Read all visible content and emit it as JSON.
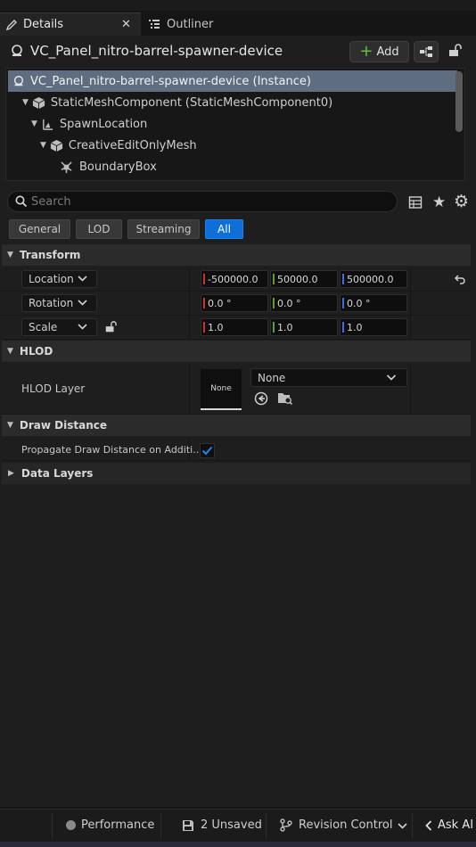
{
  "tabs": [
    {
      "label": "Details"
    },
    {
      "label": "Outliner"
    }
  ],
  "header": {
    "title": "VC_Panel_nitro-barrel-spawner-device",
    "add_label": "Add"
  },
  "tree": [
    {
      "label": "VC_Panel_nitro-barrel-spawner-device (Instance)"
    },
    {
      "label": "StaticMeshComponent (StaticMeshComponent0)"
    },
    {
      "label": "SpawnLocation"
    },
    {
      "label": "CreativeEditOnlyMesh"
    },
    {
      "label": "BoundaryBox"
    }
  ],
  "search": {
    "placeholder": "Search"
  },
  "filters": [
    {
      "label": "General"
    },
    {
      "label": "LOD"
    },
    {
      "label": "Streaming"
    },
    {
      "label": "All"
    }
  ],
  "transform": {
    "section_label": "Transform",
    "location": {
      "label": "Location",
      "x": "-500000.0",
      "y": "50000.0",
      "z": "500000.0"
    },
    "rotation": {
      "label": "Rotation",
      "x": "0.0 °",
      "y": "0.0 °",
      "z": "0.0 °"
    },
    "scale": {
      "label": "Scale",
      "x": "1.0",
      "y": "1.0",
      "z": "1.0"
    }
  },
  "hlod": {
    "section_label": "HLOD",
    "layer_label": "HLOD Layer",
    "thumbnail_text": "None",
    "dropdown_value": "None"
  },
  "draw_distance": {
    "section_label": "Draw Distance",
    "propagate_label": "Propagate Draw Distance on Additi...",
    "propagate_checked": true
  },
  "data_layers": {
    "section_label": "Data Layers"
  },
  "statusbar": {
    "performance": "Performance",
    "unsaved": "2 Unsaved",
    "revision": "Revision Control",
    "ask_ai": "Ask AI"
  },
  "colors": {
    "axis_x": "#c8352c",
    "axis_y": "#5aa038",
    "axis_z": "#3f6fd6",
    "accent": "#0e6fd8",
    "selection": "#5e6e80"
  }
}
